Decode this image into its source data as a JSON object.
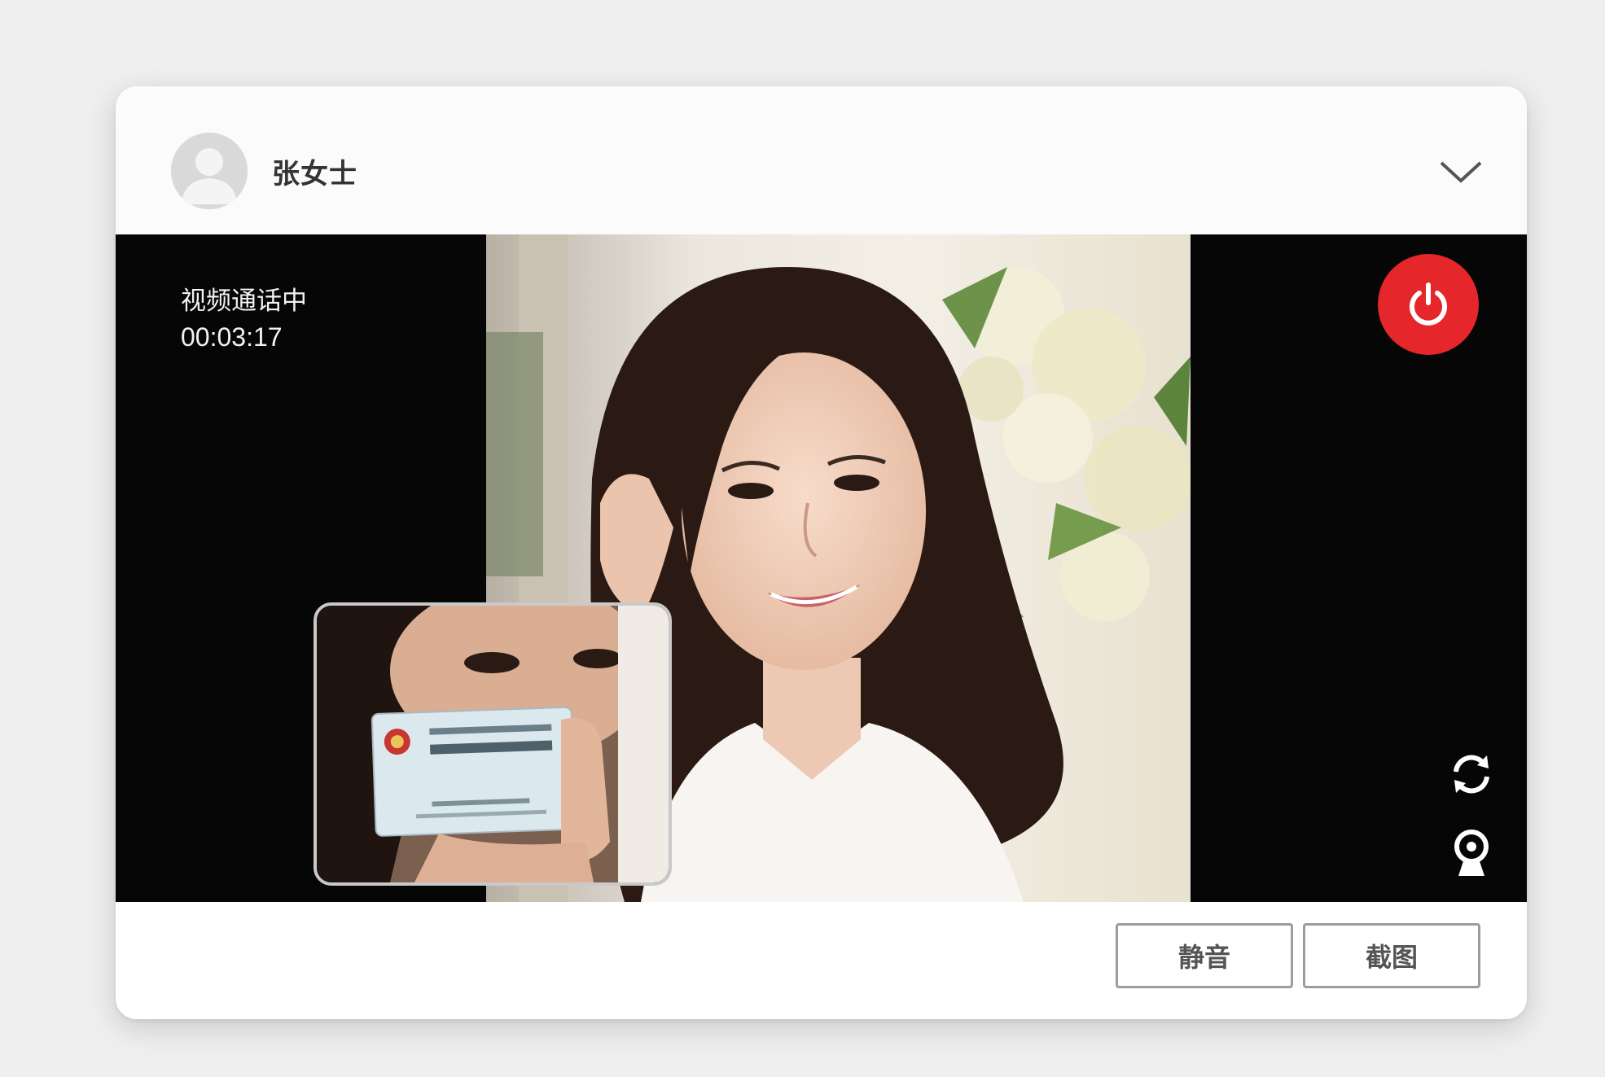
{
  "header": {
    "caller_name": "张女士",
    "avatar_icon": "user-avatar-icon",
    "collapse_icon": "chevron-down-icon"
  },
  "video": {
    "status": "视频通话中",
    "duration": "00:03:17"
  },
  "controls": {
    "hangup_icon": "power-icon",
    "hangup_color": "#e5262a",
    "switch_camera_icon": "refresh-icon",
    "webcam_icon": "webcam-icon"
  },
  "footer": {
    "mute_label": "静音",
    "screenshot_label": "截图"
  }
}
